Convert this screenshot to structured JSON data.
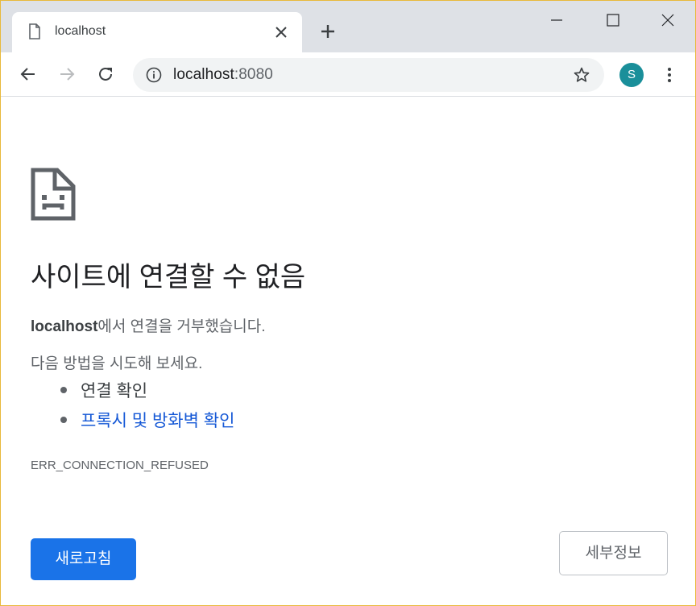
{
  "window": {
    "frame_color": "#e8b93a",
    "controls": {
      "minimize_icon": "minimize-icon",
      "maximize_icon": "maximize-icon",
      "close_icon": "close-icon"
    }
  },
  "tab": {
    "title": "localhost",
    "favicon": "page-icon",
    "close_icon": "close-icon"
  },
  "new_tab_icon": "plus-icon",
  "toolbar": {
    "back_icon": "arrow-left-icon",
    "forward_icon": "arrow-right-icon",
    "reload_icon": "reload-icon",
    "url_host": "localhost",
    "url_port": ":8080",
    "info_icon": "info-icon",
    "bookmark_icon": "star-icon",
    "profile_initial": "S",
    "profile_color": "#1a8f9a",
    "menu_icon": "more-vert-icon"
  },
  "error": {
    "icon": "sad-page-icon",
    "heading": "사이트에 연결할 수 없음",
    "host_bold": "localhost",
    "message_rest": "에서 연결을 거부했습니다.",
    "suggest_title": "다음 방법을 시도해 보세요.",
    "suggestions": [
      {
        "label": "연결 확인",
        "is_link": false
      },
      {
        "label": "프록시 및 방화벽 확인",
        "is_link": true
      }
    ],
    "code": "ERR_CONNECTION_REFUSED",
    "reload_label": "새로고침",
    "details_label": "세부정보",
    "accent_color": "#1a73e8",
    "link_color": "#1558d6"
  }
}
